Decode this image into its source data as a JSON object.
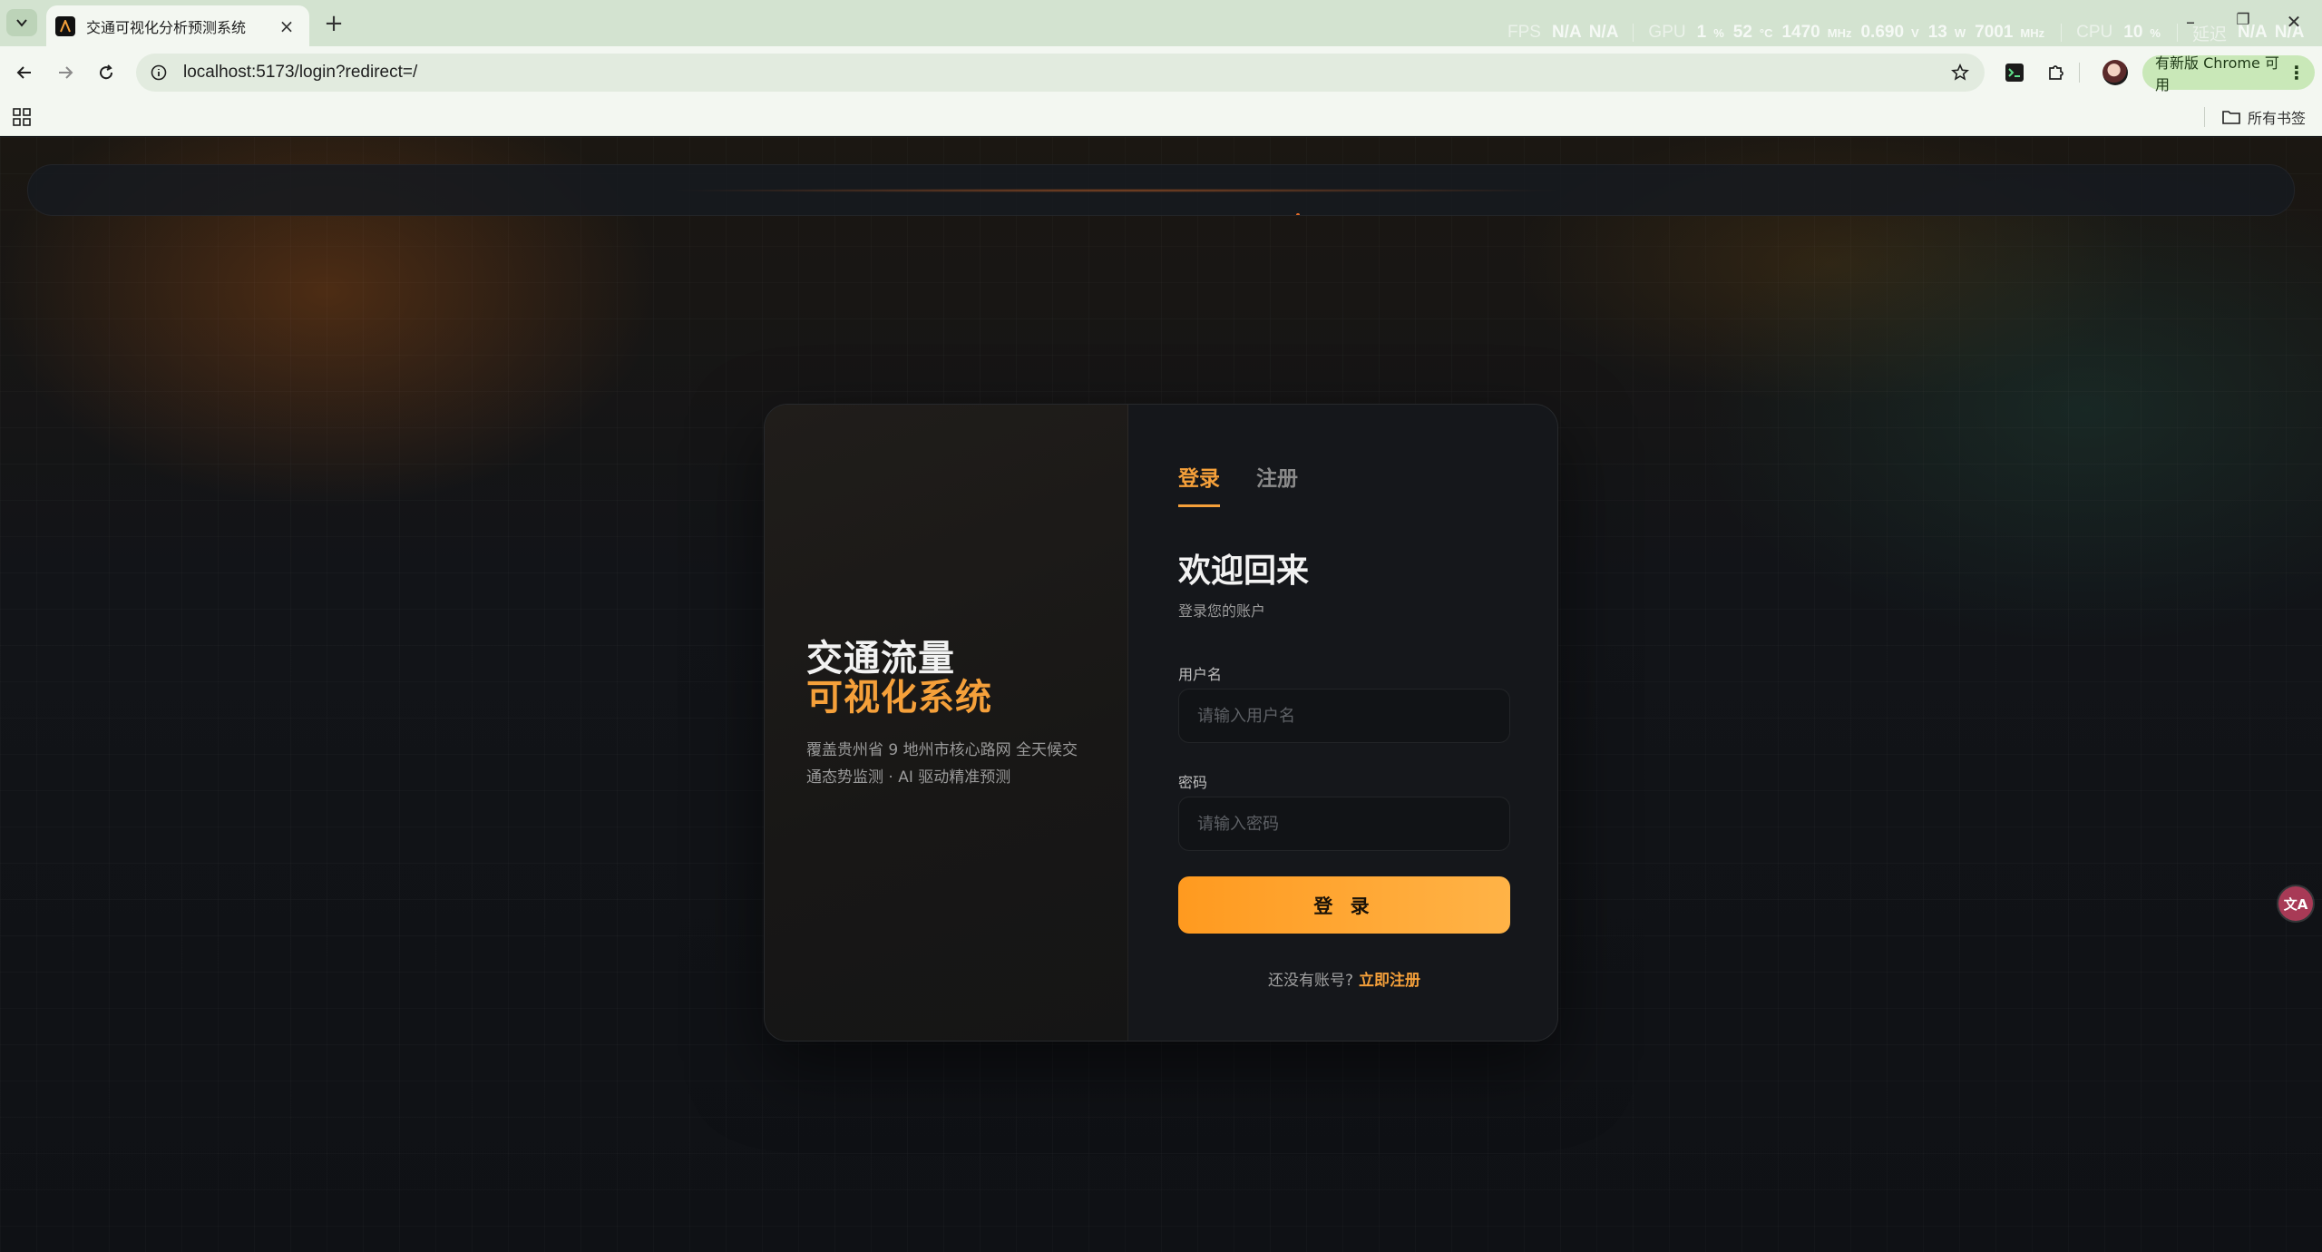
{
  "browser": {
    "tab_title": "交通可视化分析预测系统",
    "url": "localhost:5173/login?redirect=/",
    "update_label": "有新版 Chrome 可用",
    "bookmarks_all": "所有书签"
  },
  "perf_overlay": {
    "fps_label": "FPS",
    "fps_value1": "N/A",
    "fps_value2": "N/A",
    "gpu_label": "GPU",
    "gpu_util": "1",
    "gpu_util_unit": "%",
    "gpu_temp": "52",
    "gpu_temp_unit": "°C",
    "gpu_clock": "1470",
    "gpu_clock_unit": "MHz",
    "gpu_voltage": "0.690",
    "gpu_voltage_unit": "V",
    "gpu_power": "13",
    "gpu_power_unit": "W",
    "mem_clock": "7001",
    "mem_clock_unit": "MHz",
    "cpu_label": "CPU",
    "cpu_util": "10",
    "cpu_util_unit": "%",
    "latency_label": "延迟",
    "latency_value1": "N/A",
    "latency_value2": "N/A"
  },
  "brand": {
    "line1": "交通流量",
    "line2": "可视化系统",
    "desc": "覆盖贵州省 9 地州市核心路网 全天候交通态势监测 · AI 驱动精准预测"
  },
  "auth": {
    "tabs": [
      {
        "label": "登录"
      },
      {
        "label": "注册"
      }
    ],
    "welcome": "欢迎回来",
    "subtitle": "登录您的账户",
    "username_label": "用户名",
    "username_placeholder": "请输入用户名",
    "password_label": "密码",
    "password_placeholder": "请输入密码",
    "submit": "登 录",
    "no_account": "还没有账号?",
    "register_link": "立即注册"
  },
  "floating": {
    "label": "文A"
  },
  "colors": {
    "accent": "#f5a03a",
    "button_start": "#ff9a1f",
    "button_end": "#ffb347",
    "chrome_bg": "#d3e3d0"
  }
}
